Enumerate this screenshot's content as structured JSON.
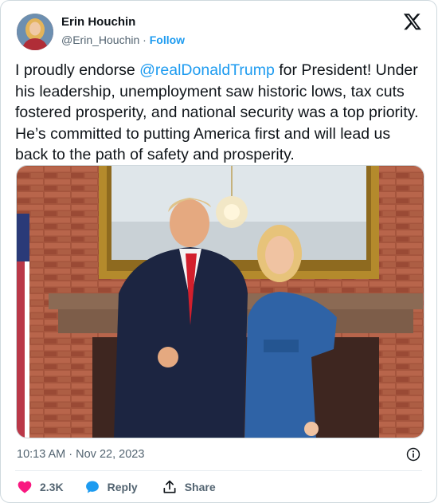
{
  "author": {
    "name": "Erin Houchin",
    "handle": "@Erin_Houchin",
    "separator": "·",
    "follow_label": "Follow"
  },
  "tweet": {
    "text_before": "I proudly endorse ",
    "mention": "@realDonaldTrump",
    "text_after": " for President! Under his leadership, unemployment saw historic lows, tax cuts fostered prosperity, and national security was a top priority. He’s committed to putting America first and will lead us back to the path of safety and prosperity.",
    "timestamp": "10:13 AM · Nov 22, 2023"
  },
  "actions": {
    "likes_count": "2.3K",
    "reply_label": "Reply",
    "share_label": "Share"
  },
  "icons": {
    "brand": "x-logo-icon",
    "info": "info-icon",
    "like": "heart-icon",
    "reply": "speech-bubble-icon",
    "share": "share-icon"
  },
  "colors": {
    "link": "#1d9bf0",
    "like": "#f91880",
    "secondary_text": "#536471",
    "primary_text": "#0f1419"
  }
}
